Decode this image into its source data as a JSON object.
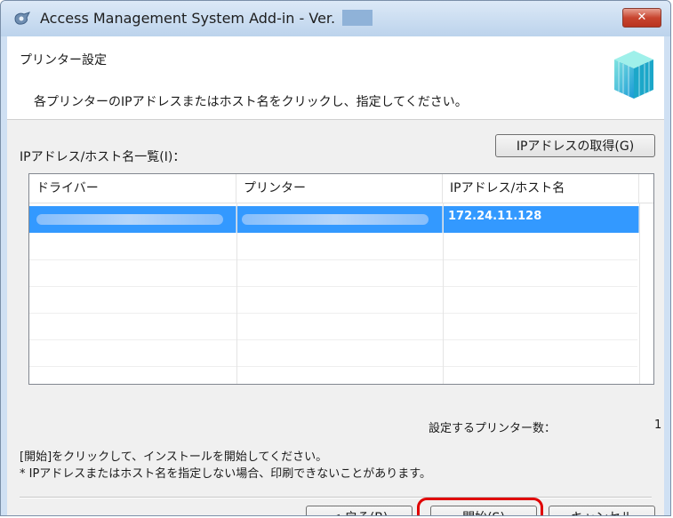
{
  "window": {
    "title": "Access Management System Add-in - Ver.",
    "close_label": "✕"
  },
  "header": {
    "section_title": "プリンター設定",
    "instruction": "各プリンターのIPアドレスまたはホスト名をクリックし、指定してください。"
  },
  "list": {
    "label": "IPアドレス/ホスト名一覧(I)：",
    "get_ip_button": "IPアドレスの取得(G)",
    "columns": [
      "ドライバー",
      "プリンター",
      "IPアドレス/ホスト名"
    ],
    "rows": [
      {
        "driver": "",
        "printer": "",
        "ip": "172.24.11.128",
        "selected": true
      }
    ]
  },
  "summary": {
    "count_label": "設定するプリンター数：",
    "count_value": "1"
  },
  "notes": [
    "[開始]をクリックして、インストールを開始してください。",
    "* IPアドレスまたはホスト名を指定しない場合、印刷できないことがあります。"
  ],
  "buttons": {
    "back": "< 戻る(B)",
    "start": "開始(S)",
    "cancel": "キャンセル"
  },
  "colors": {
    "selection": "#3399ff",
    "highlight_ring": "#e00000",
    "titlebar": "#cfe0f3"
  },
  "icons": [
    "app-icon",
    "close-icon",
    "printer-cube-icon"
  ]
}
